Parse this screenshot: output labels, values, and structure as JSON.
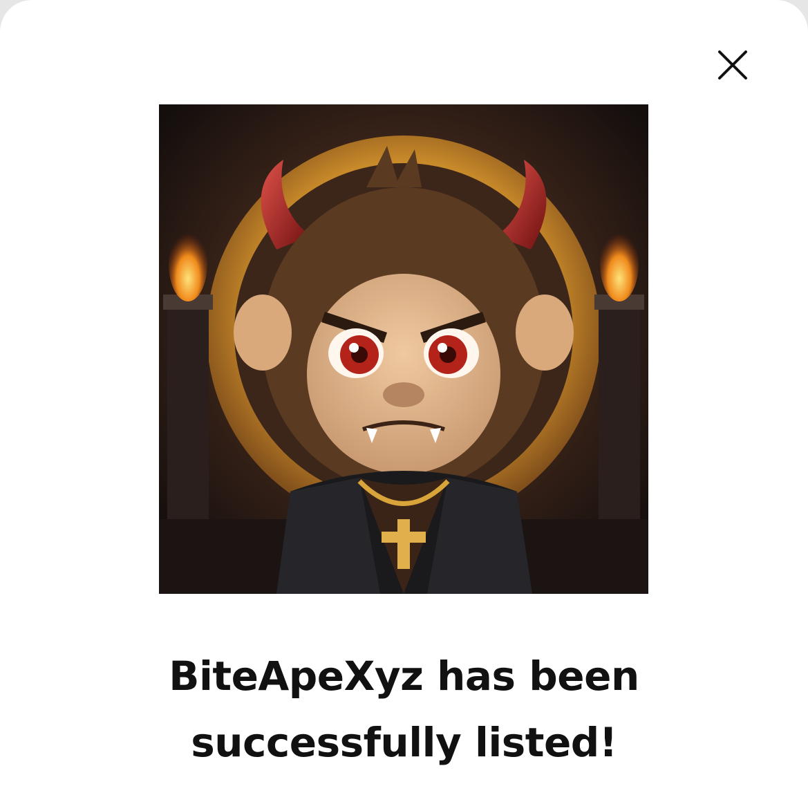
{
  "dialog": {
    "close_icon": "close-icon",
    "image_alt": "BiteApeXyz NFT artwork: devil monkey with red horns and leather jacket",
    "message_line1": "BiteApeXyz has been",
    "message_line2": "successfully listed!"
  },
  "colors": {
    "modal_background": "#ffffff",
    "text": "#111111",
    "backdrop": "#e6e6e6"
  }
}
